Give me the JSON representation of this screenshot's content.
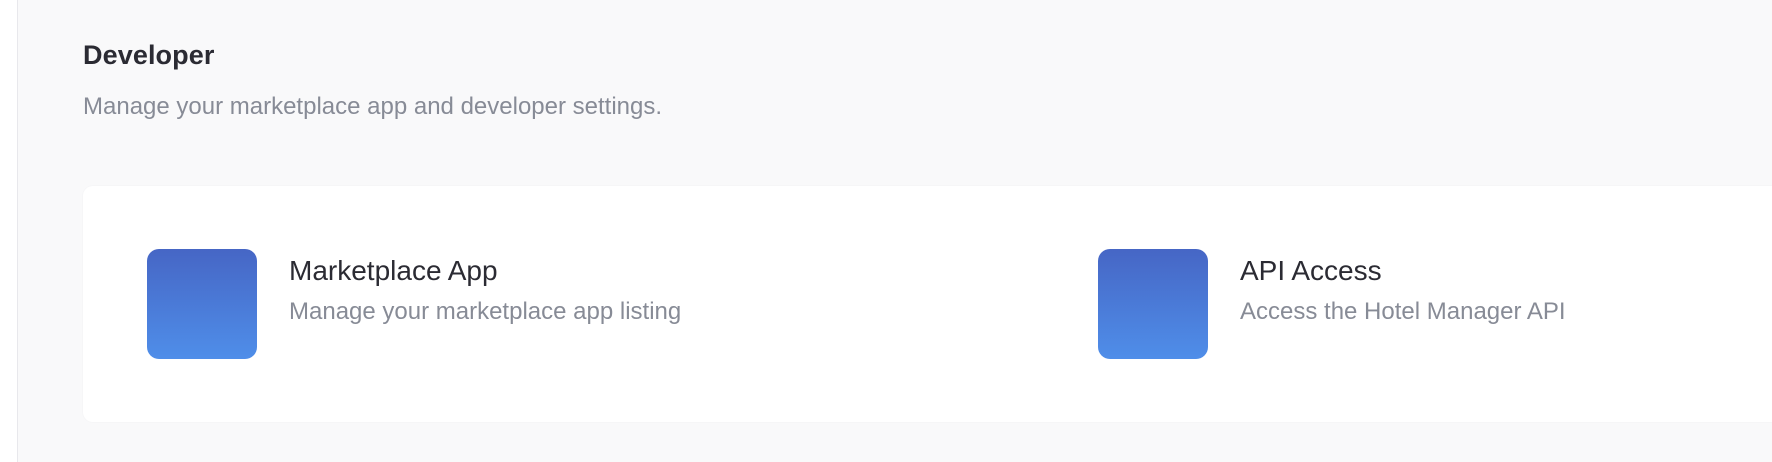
{
  "header": {
    "title": "Developer",
    "subtitle": "Manage your marketplace app and developer settings."
  },
  "items": [
    {
      "title": "Marketplace App",
      "description": "Manage your marketplace app listing",
      "icon": "marketplace-app-icon",
      "icon_gradient": [
        "#4666c5",
        "#4f8ee9"
      ]
    },
    {
      "title": "API Access",
      "description": "Access the Hotel Manager API",
      "icon": "api-access-icon",
      "icon_gradient": [
        "#4666c5",
        "#4f8ee9"
      ]
    }
  ],
  "colors": {
    "page_background": "#f9f9fa",
    "card_background": "#ffffff",
    "title_text": "#2b2b33",
    "muted_text": "#878b96"
  }
}
